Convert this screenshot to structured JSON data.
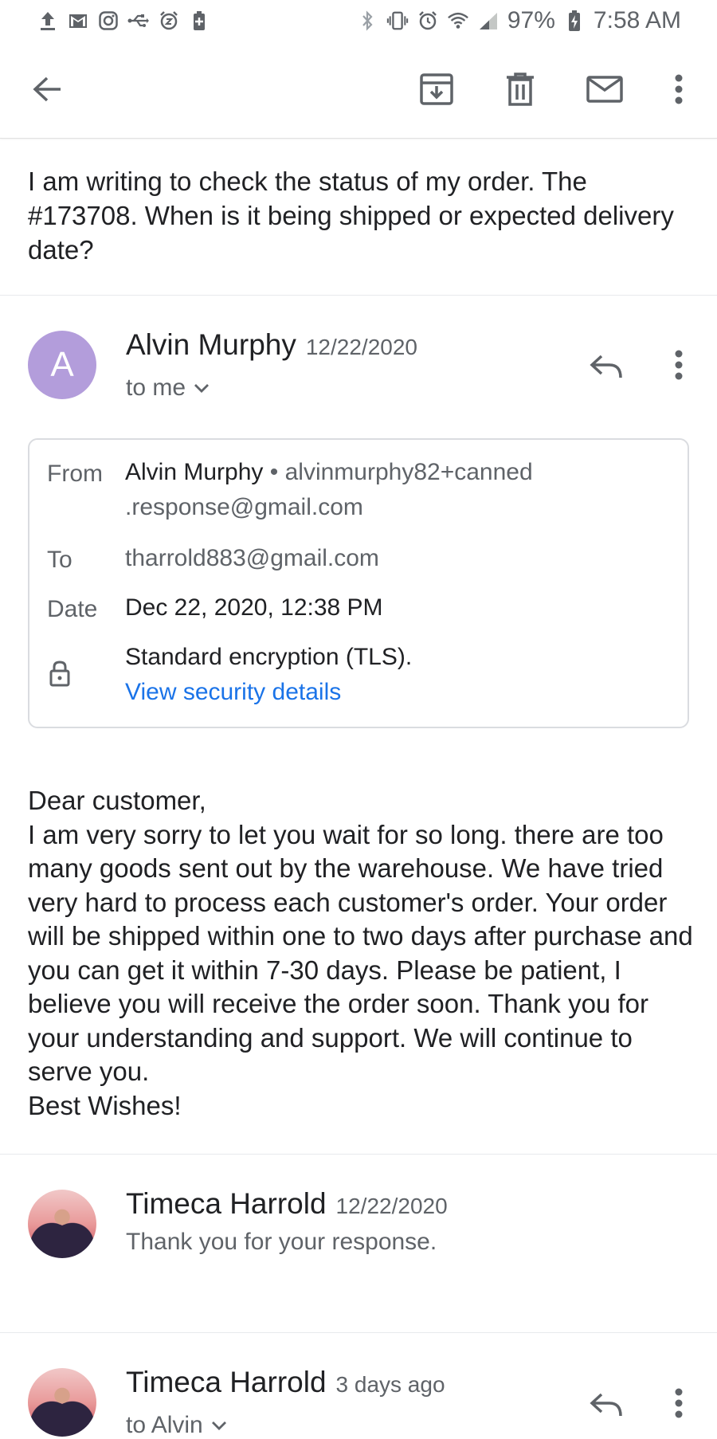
{
  "status_bar": {
    "battery": "97%",
    "time": "7:58 AM"
  },
  "subject": "I am writing to check the status of my order. The #173708. When is it being shipped or expected delivery date?",
  "message1": {
    "avatar_letter": "A",
    "avatar_color": "#b39ddb",
    "sender": "Alvin Murphy",
    "date": "12/22/2020",
    "recipient": "to me",
    "details": {
      "from_label": "From",
      "from_name": "Alvin Murphy",
      "from_email_line1": "• alvinmurphy82+canned",
      "from_email_line2": ".response@gmail.com",
      "to_label": "To",
      "to_value": "tharrold883@gmail.com",
      "date_label": "Date",
      "date_value": "Dec 22, 2020, 12:38 PM",
      "encryption": "Standard encryption (TLS).",
      "security_link": "View security details"
    },
    "body": [
      "Dear customer,",
      "I am very sorry to let you wait for so long. there are too many goods sent out by the warehouse. We have tried very hard to process each customer's order. Your order will be shipped within one to two days after purchase and you can get it within 7-30 days. Please be patient, I believe you will receive the order soon. Thank you for your understanding and support. We will continue to serve you.",
      "Best Wishes!"
    ]
  },
  "message2": {
    "sender": "Timeca Harrold",
    "date": "12/22/2020",
    "snippet": "Thank you for your response."
  },
  "message3": {
    "sender": "Timeca Harrold",
    "date": "3 days ago",
    "recipient": "to Alvin"
  },
  "colors": {
    "link": "#1a73e8",
    "secondary_text": "#5f6368"
  }
}
